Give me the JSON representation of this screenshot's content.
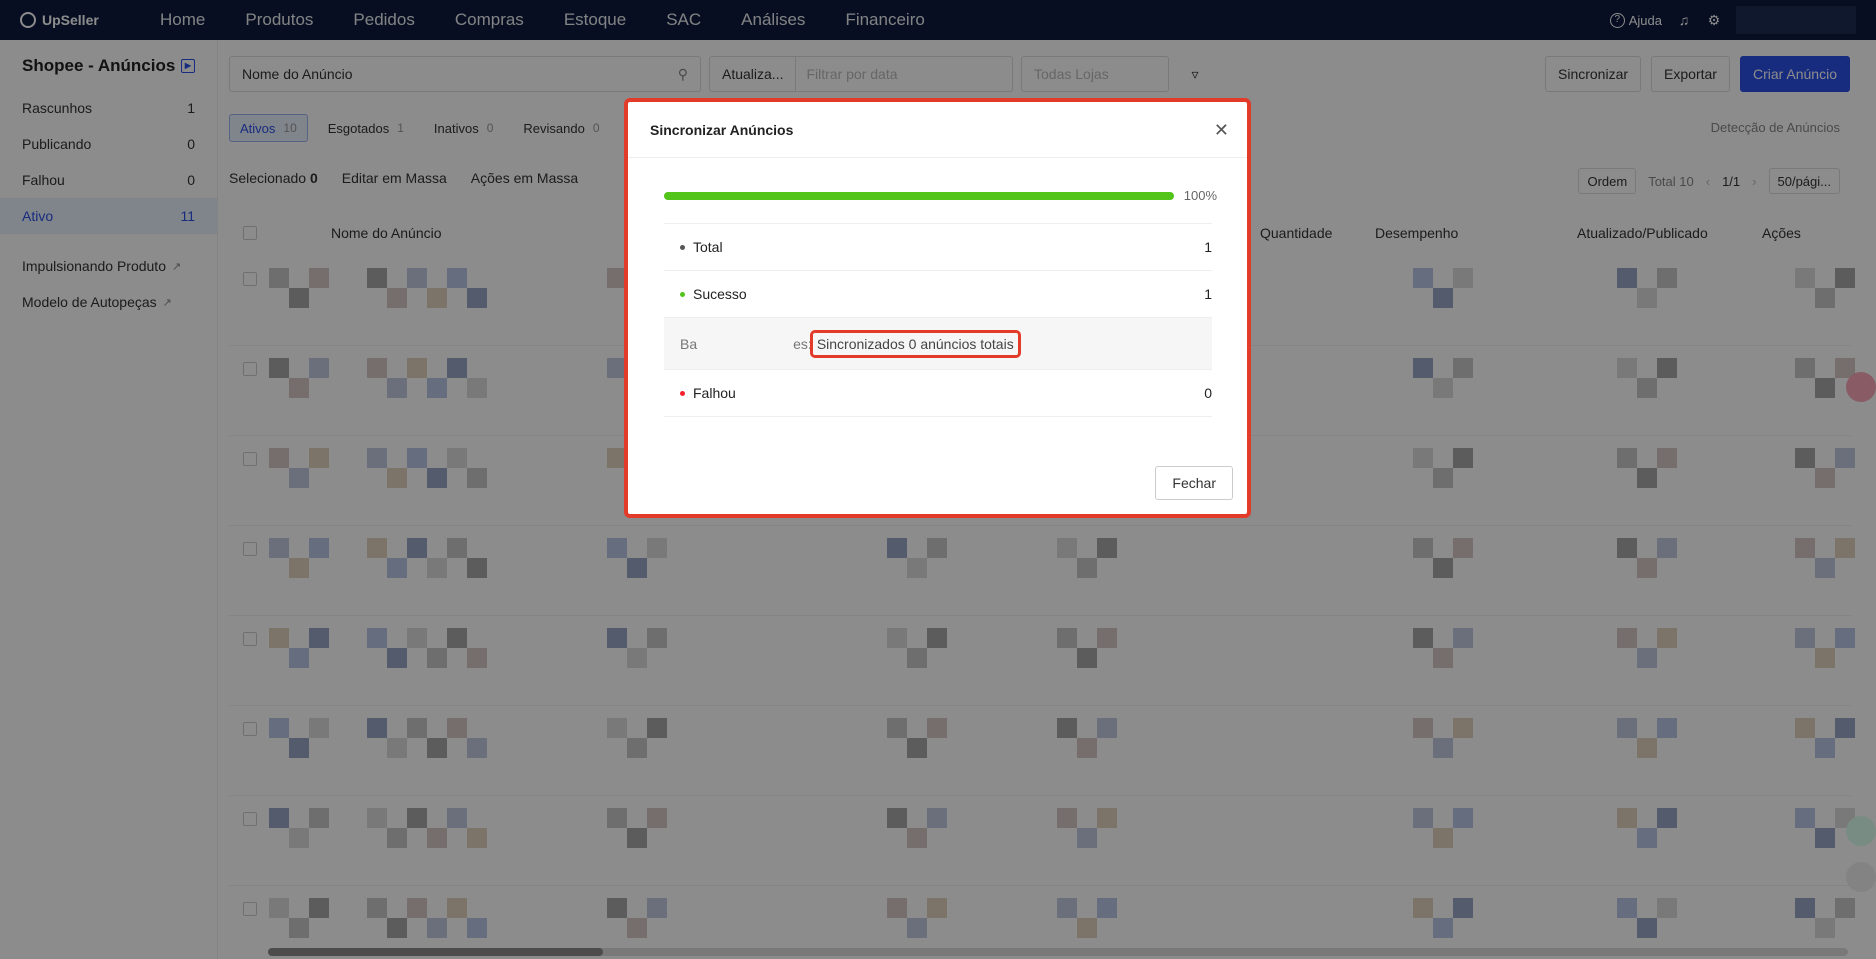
{
  "app": {
    "logo_text": "UpSeller"
  },
  "topnav": {
    "items": [
      "Home",
      "Produtos",
      "Pedidos",
      "Compras",
      "Estoque",
      "SAC",
      "Análises",
      "Financeiro"
    ],
    "help_label": "Ajuda"
  },
  "sidebar": {
    "title": "Shopee - Anúncios",
    "items": [
      {
        "label": "Rascunhos",
        "count": "1"
      },
      {
        "label": "Publicando",
        "count": "0"
      },
      {
        "label": "Falhou",
        "count": "0"
      },
      {
        "label": "Ativo",
        "count": "11"
      }
    ],
    "links": [
      "Impulsionando Produto",
      "Modelo de Autopeças"
    ]
  },
  "filters": {
    "name_select": "Nome do Anúncio",
    "date_select": "Atualiza...",
    "date_placeholder": "Filtrar por data",
    "store_select": "Todas Lojas"
  },
  "actions": {
    "sync": "Sincronizar",
    "export": "Exportar",
    "create": "Criar Anúncio"
  },
  "tabs": [
    {
      "label": "Ativos",
      "count": "10"
    },
    {
      "label": "Esgotados",
      "count": "1"
    },
    {
      "label": "Inativos",
      "count": "0"
    },
    {
      "label": "Revisando",
      "count": "0"
    }
  ],
  "detect_label": "Detecção de Anúncios",
  "toolbar": {
    "selected_label": "Selecionado",
    "selected_count": "0",
    "bulk_edit": "Editar em Massa",
    "bulk_actions": "Ações em Massa",
    "order": "Ordem",
    "total": "Total 10",
    "page": "1/1",
    "per_page": "50/pági..."
  },
  "table": {
    "headers": {
      "name": "Nome do Anúncio",
      "quantity": "Quantidade",
      "performance": "Desempenho",
      "updated": "Atualizado/Publicado",
      "actions": "Ações"
    }
  },
  "modal": {
    "title": "Sincronizar Anúncios",
    "progress": 100,
    "progress_text": "100%",
    "rows": [
      {
        "label": "Total",
        "value": "1",
        "color": "#555555"
      },
      {
        "label": "Sucesso",
        "value": "1",
        "color": "#52c41a"
      }
    ],
    "detail_prefix": "Ba",
    "detail_suffix": "es:",
    "detail_text": "Sincronizados 0 anúncios totais",
    "fail": {
      "label": "Falhou",
      "value": "0",
      "color": "#f5222d"
    },
    "close_button": "Fechar"
  },
  "colors": {
    "nav_bg": "#0d1b3e",
    "accent": "#2a50e6",
    "highlight": "#e33b2a"
  }
}
